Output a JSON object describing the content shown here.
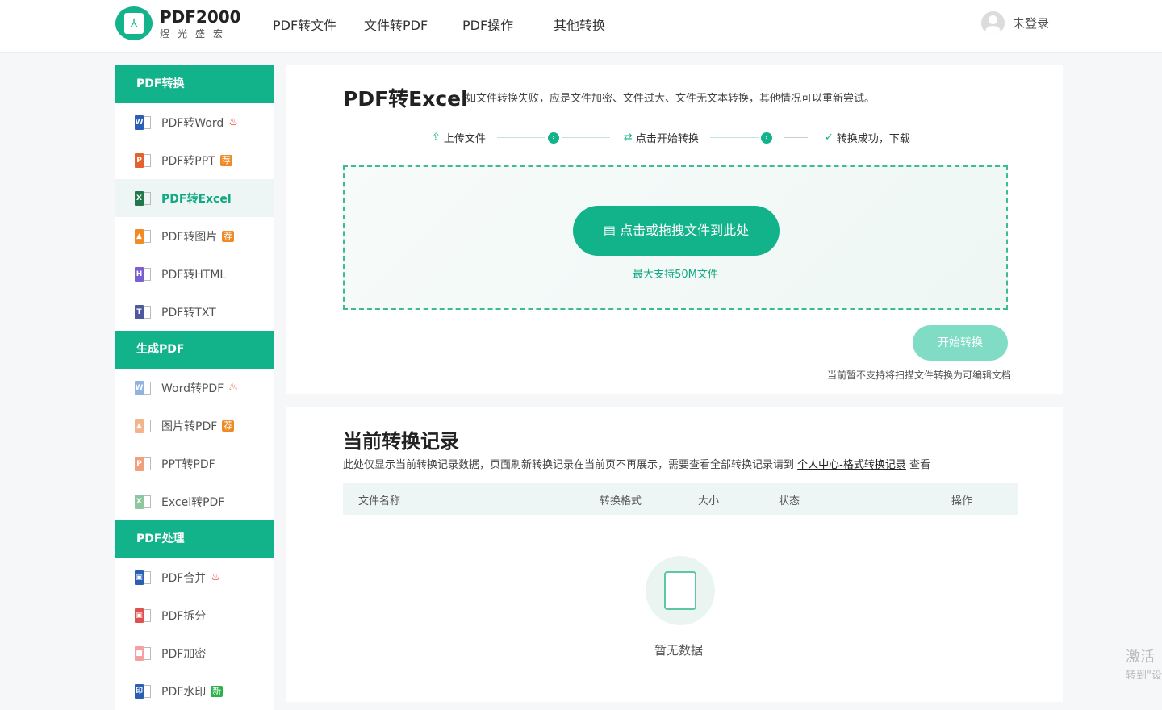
{
  "header": {
    "logo_title": "PDF2000",
    "logo_sub": "煜光盛宏",
    "nav": [
      "PDF转文件",
      "文件转PDF",
      "PDF操作",
      "其他转换"
    ],
    "user": "未登录"
  },
  "sidebar": {
    "sections": [
      {
        "title": "PDF转换",
        "items": [
          {
            "label": "PDF转Word",
            "icon": "W",
            "color": "#2b5fb4",
            "tag": "fire"
          },
          {
            "label": "PDF转PPT",
            "icon": "P",
            "color": "#e4622e",
            "tag": "荐"
          },
          {
            "label": "PDF转Excel",
            "icon": "X",
            "color": "#21784a",
            "active": true
          },
          {
            "label": "PDF转图片",
            "icon": "▲",
            "color": "#f08a24",
            "tag": "荐"
          },
          {
            "label": "PDF转HTML",
            "icon": "H",
            "color": "#7a5fd0"
          },
          {
            "label": "PDF转TXT",
            "icon": "T",
            "color": "#4b5aa0"
          }
        ]
      },
      {
        "title": "生成PDF",
        "items": [
          {
            "label": "Word转PDF",
            "icon": "W",
            "color": "#8fb4e0",
            "tag": "fire"
          },
          {
            "label": "图片转PDF",
            "icon": "▲",
            "color": "#f2b48a",
            "tag": "荐"
          },
          {
            "label": "PPT转PDF",
            "icon": "P",
            "color": "#f0a07a"
          },
          {
            "label": "Excel转PDF",
            "icon": "X",
            "color": "#8cc7a0"
          }
        ]
      },
      {
        "title": "PDF处理",
        "items": [
          {
            "label": "PDF合并",
            "icon": "▣",
            "color": "#2b5fb4",
            "tag": "fire"
          },
          {
            "label": "PDF拆分",
            "icon": "▣",
            "color": "#e05050"
          },
          {
            "label": "PDF加密",
            "icon": "■",
            "color": "#f3a0a0"
          },
          {
            "label": "PDF水印",
            "icon": "印",
            "color": "#2b5fb4",
            "tag": "新"
          }
        ]
      }
    ]
  },
  "main": {
    "title": "PDF转Excel",
    "note": "如文件转换失败，应是文件加密、文件过大、文件无文本转换，其他情况可以重新尝试。",
    "steps": [
      "上传文件",
      "点击开始转换",
      "转换成功，下载"
    ],
    "upload_label": "点击或拖拽文件到此处",
    "limit": "最大支持50M文件",
    "start_label": "开始转换",
    "scan_note": "当前暂不支持将扫描文件转换为可编辑文档"
  },
  "records": {
    "title": "当前转换记录",
    "note": "此处仅显示当前转换记录数据，页面刷新转换记录在当前页不再展示，需要查看全部转换记录请到",
    "link": "个人中心-格式转换记录",
    "note_end": "查看",
    "columns": [
      "文件名称",
      "转换格式",
      "大小",
      "状态",
      "操作"
    ],
    "empty": "暂无数据"
  },
  "watermark": {
    "line1": "激活",
    "line2": "转到\"设"
  }
}
